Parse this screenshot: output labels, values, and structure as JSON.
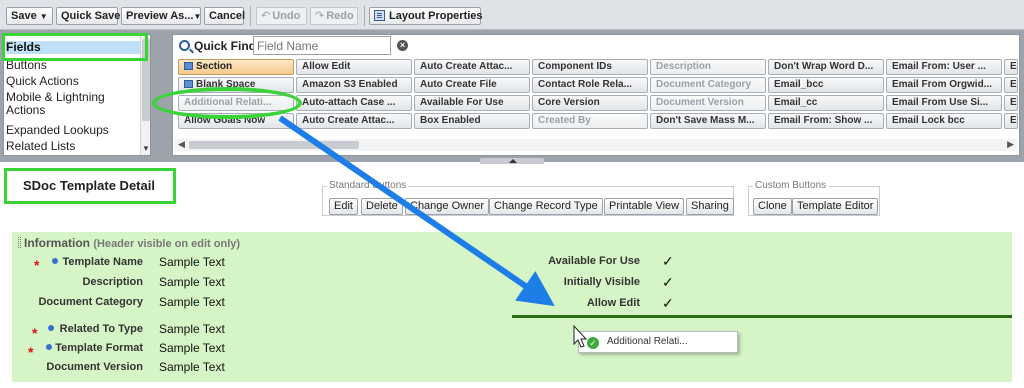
{
  "toolbar": {
    "save": "Save",
    "quick_save": "Quick Save",
    "preview_as": "Preview As...",
    "cancel": "Cancel",
    "undo": "Undo",
    "redo": "Redo",
    "layout_properties": "Layout Properties"
  },
  "palette": {
    "categories": [
      "Fields",
      "Buttons",
      "Quick Actions",
      "Mobile & Lightning",
      "Actions",
      "Expanded Lookups",
      "Related Lists"
    ],
    "quick_find_label": "Quick Find",
    "quick_find_placeholder": "Field Name",
    "fields": [
      [
        "Section",
        "Allow Edit",
        "Auto Create Attac...",
        "Component IDs",
        "Description",
        "Don't Wrap Word D...",
        "Email From: User ...",
        "Em"
      ],
      [
        "Blank Space",
        "Amazon S3 Enabled",
        "Auto Create File",
        "Contact Role Rela...",
        "Document Category",
        "Email_bcc",
        "Email From Orgwid...",
        "Em"
      ],
      [
        "Additional Relati...",
        "Auto-attach Case ...",
        "Available For Use",
        "Core Version",
        "Document Version",
        "Email_cc",
        "Email From Use Si...",
        "Em"
      ],
      [
        "Allow Goals Now",
        "Auto Create Attac...",
        "Box Enabled",
        "Created By",
        "Don't Save Mass M...",
        "Email From: Show ...",
        "Email Lock bcc",
        "Em"
      ]
    ]
  },
  "layout": {
    "page_title": "SDoc Template Detail",
    "standard_buttons_title": "Standard Buttons",
    "standard_buttons": [
      "Edit",
      "Delete",
      "Change Owner",
      "Change Record Type",
      "Printable View",
      "Sharing"
    ],
    "custom_buttons_title": "Custom Buttons",
    "custom_buttons": [
      "Clone",
      "Template Editor"
    ],
    "section_title": "Information",
    "section_subtitle": "(Header visible on edit only)",
    "left_fields": [
      {
        "label": "Template Name",
        "value": "Sample Text"
      },
      {
        "label": "Description",
        "value": "Sample Text"
      },
      {
        "label": "Document Category",
        "value": "Sample Text"
      },
      {
        "label": "Related To Type",
        "value": "Sample Text"
      },
      {
        "label": "Template Format",
        "value": "Sample Text"
      },
      {
        "label": "Document Version",
        "value": "Sample Text"
      }
    ],
    "right_fields": [
      {
        "label": "Available For Use",
        "value": "✓"
      },
      {
        "label": "Initially Visible",
        "value": "✓"
      },
      {
        "label": "Allow Edit",
        "value": "✓"
      }
    ],
    "drag_chip": "Additional Relati..."
  },
  "colors": {
    "highlight": "#38d438",
    "arrow": "#1e7ee8",
    "section_bg": "#d6f5c6"
  }
}
